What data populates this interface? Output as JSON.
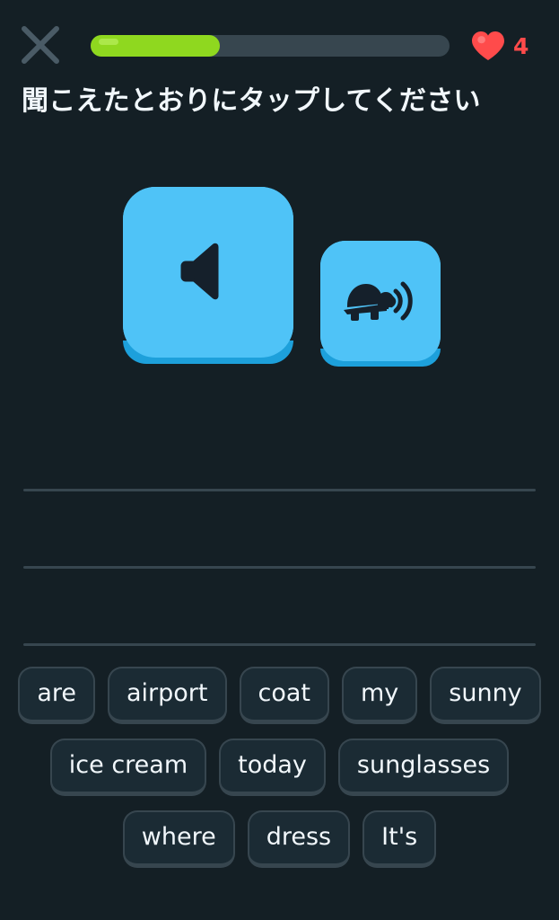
{
  "app": {
    "name": "duolingo-listening-exercise",
    "background_color": "#141F25"
  },
  "header": {
    "close_icon": "close-x-icon",
    "close_label": "Close lesson",
    "progress": {
      "percent": 36,
      "fill_color": "#8FD81F",
      "track_color": "#37464F"
    },
    "hearts": {
      "icon": "heart-icon",
      "count": "4",
      "color": "#FF4B4B"
    }
  },
  "prompt": {
    "title": "聞こえたとおりにタップしてください"
  },
  "audio": {
    "play_button": {
      "icon": "speaker-icon",
      "label": "Play audio",
      "color": "#4FC3F7",
      "shadow_color": "#1DA0DB"
    },
    "slow_button": {
      "icon": "turtle-slow-audio-icon",
      "label": "Play slow audio",
      "color": "#4FC3F7",
      "shadow_color": "#1DA0DB"
    }
  },
  "answer": {
    "line_color": "#37464F",
    "lines": [
      "",
      "",
      ""
    ]
  },
  "word_bank": {
    "rows": [
      [
        "are",
        "airport",
        "coat",
        "my",
        "sunny"
      ],
      [
        "ice cream",
        "today",
        "sunglasses"
      ],
      [
        "where",
        "dress",
        "It's"
      ]
    ]
  }
}
